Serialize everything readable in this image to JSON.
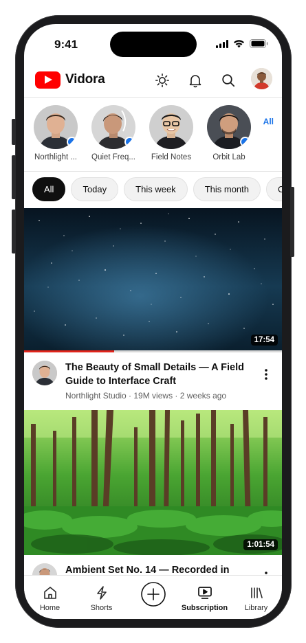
{
  "status": {
    "time": "9:41"
  },
  "header": {
    "app_name": "Vidora"
  },
  "channels": [
    {
      "name": "Northlight ...",
      "new": true
    },
    {
      "name": "Quiet Freq...",
      "new": true
    },
    {
      "name": "Field Notes",
      "new": false
    },
    {
      "name": "Orbit Lab",
      "new": true
    }
  ],
  "channels_all_label": "All",
  "chips": [
    "All",
    "Today",
    "This week",
    "This month",
    "C"
  ],
  "videos": [
    {
      "duration": "17:54",
      "watched_fraction": 0.35,
      "title": "The Beauty of Small Details — A Field Guide to Interface Craft",
      "meta": "Northlight Studio · 19M views · 2 weeks ago"
    },
    {
      "duration": "1:01:54",
      "title": "Ambient Set No. 14 — Recorded in"
    }
  ],
  "tabs": [
    {
      "label": "Home",
      "icon": "home-icon"
    },
    {
      "label": "Shorts",
      "icon": "shorts-icon"
    },
    {
      "label": "",
      "icon": "create-icon"
    },
    {
      "label": "Subscription",
      "icon": "subscriptions-icon",
      "active": true
    },
    {
      "label": "Library",
      "icon": "library-icon"
    }
  ],
  "colors": {
    "brand": "#ff0000",
    "accent": "#1a73e8",
    "progress": "#e1251b"
  }
}
